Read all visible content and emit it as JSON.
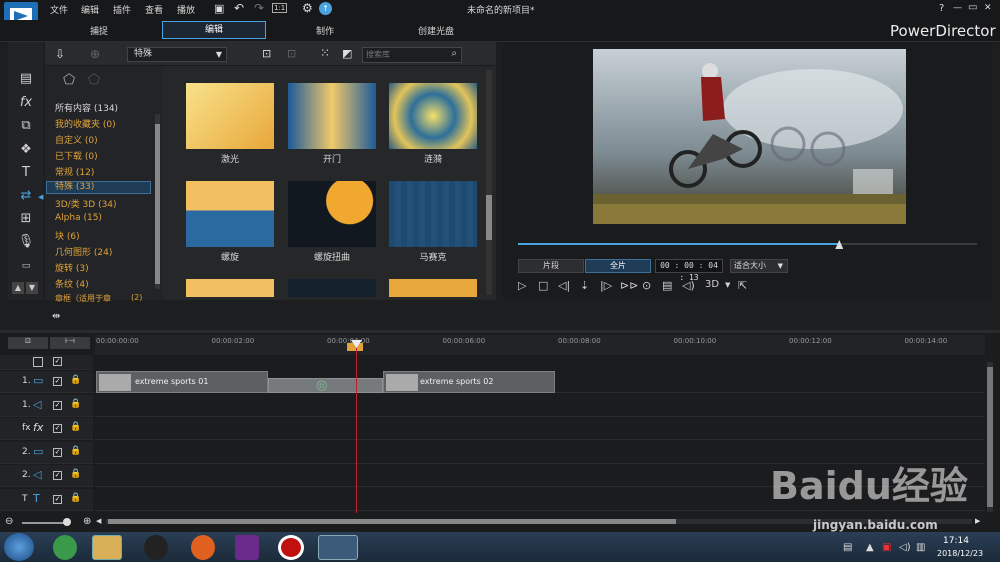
{
  "menubar": {
    "items": [
      "文件",
      "编辑",
      "插件",
      "查看",
      "播放"
    ],
    "zoom": "1:1",
    "project_title": "未命名的新项目*"
  },
  "window_controls": {
    "help": "?",
    "min": "—",
    "restore": "▭",
    "close": "✕"
  },
  "modes": {
    "capture": "捕捉",
    "edit": "编辑",
    "produce": "制作",
    "disc": "创建光盘"
  },
  "brand": "PowerDirector",
  "library": {
    "filter": "特殊",
    "search_placeholder": "搜索库",
    "categories": [
      {
        "label": "所有内容 (134)",
        "color": "w"
      },
      {
        "label": "我的收藏夹 (0)",
        "color": "o"
      },
      {
        "label": "自定义 (0)",
        "color": "o"
      },
      {
        "label": "已下载 (0)",
        "color": "o"
      },
      {
        "label": "常规 (12)",
        "color": "o"
      },
      {
        "label": "特殊 (33)",
        "color": "sel"
      },
      {
        "label": "3D/类 3D (34)",
        "color": "o"
      },
      {
        "label": "Alpha (15)",
        "color": "o"
      },
      {
        "label": "块 (6)",
        "color": "o"
      },
      {
        "label": "几何图形 (24)",
        "color": "o"
      },
      {
        "label": "旋转 (3)",
        "color": "o"
      },
      {
        "label": "条纹 (4)",
        "color": "o"
      },
      {
        "label": "章框（适用于章",
        "color": "o"
      },
      {
        "label": "(2)",
        "color": "o"
      }
    ],
    "items": [
      {
        "label": "激光",
        "icon": "laser-transition"
      },
      {
        "label": "开门",
        "icon": "door-open-transition"
      },
      {
        "label": "涟漪",
        "icon": "ripple-transition"
      },
      {
        "label": "螺旋",
        "icon": "spiral-transition"
      },
      {
        "label": "螺旋扭曲",
        "icon": "spiral-twist-transition"
      },
      {
        "label": "马赛克",
        "icon": "mosaic-transition"
      }
    ]
  },
  "preview": {
    "clip_btn": "片段",
    "movie_btn": "全片",
    "timecode": "00 : 00 : 04 : 13",
    "fit": "适合大小",
    "mode3d": "3D",
    "progress": 0.7
  },
  "timeline": {
    "ticks": [
      "00:00:00:00",
      "00:00:02:00",
      "00:00:04:00",
      "00:00:06:00",
      "00:00:08:00",
      "00:00:10:00",
      "00:00:12:00",
      "00:00:14:00"
    ],
    "tracks": [
      {
        "label": "1.",
        "type": "video"
      },
      {
        "label": "1.",
        "type": "audio"
      },
      {
        "label": "fx",
        "type": "fx"
      },
      {
        "label": "2.",
        "type": "video"
      },
      {
        "label": "2.",
        "type": "audio"
      },
      {
        "label": "T",
        "type": "title"
      }
    ],
    "clips": [
      {
        "label": "extreme sports 01"
      },
      {
        "label": "extreme sports 02"
      }
    ]
  },
  "taskbar": {
    "time": "17:14",
    "date": "2018/12/23"
  },
  "watermark": {
    "brand": "Baidu经验",
    "url": "jingyan.baidu.com"
  },
  "colors": {
    "accent": "#4aa3df",
    "orange": "#e0a33a",
    "playhead": "#c0202a"
  }
}
